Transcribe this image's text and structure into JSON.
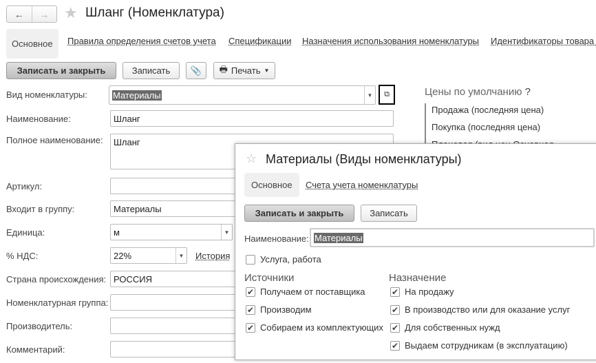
{
  "header": {
    "title": "Шланг (Номенклатура)",
    "back_icon": "arrow-left-icon",
    "forward_icon": "arrow-right-icon"
  },
  "tabs": [
    {
      "label": "Основное",
      "active": true
    },
    {
      "label": "Правила определения счетов учета"
    },
    {
      "label": "Спецификации"
    },
    {
      "label": "Назначения использования номенклатуры"
    },
    {
      "label": "Идентификаторы товара в"
    }
  ],
  "toolbar": {
    "save_close": "Записать и закрыть",
    "save": "Записать",
    "print": "Печать"
  },
  "form": {
    "kind": {
      "label": "Вид номенклатуры:",
      "value": "Материалы"
    },
    "name": {
      "label": "Наименование:",
      "value": "Шланг"
    },
    "full_name": {
      "label": "Полное наименование:",
      "value": "Шланг"
    },
    "article": {
      "label": "Артикул:",
      "value": ""
    },
    "group": {
      "label": "Входит в группу:",
      "value": "Материалы"
    },
    "unit": {
      "label": "Единица:",
      "value": "м"
    },
    "vat": {
      "label": "% НДС:",
      "value": "22%",
      "history": "История"
    },
    "country": {
      "label": "Страна происхождения:",
      "value": "РОССИЯ"
    },
    "nom_group": {
      "label": "Номенклатурная группа:",
      "value": ""
    },
    "manufacturer": {
      "label": "Производитель:",
      "value": ""
    },
    "comment": {
      "label": "Комментарий:",
      "value": ""
    }
  },
  "prices": {
    "title": "Цены по умолчанию",
    "help": "?",
    "items": [
      "Продажа (последняя цена)",
      "Покупка (последняя цена)",
      "Плановая (вид цен Основная"
    ]
  },
  "popup": {
    "title": "Материалы (Виды номенклатуры)",
    "tabs": [
      {
        "label": "Основное",
        "active": true
      },
      {
        "label": "Счета учета номенклатуры"
      }
    ],
    "save_close": "Записать и закрыть",
    "save": "Записать",
    "name_label": "Наименование:",
    "name_value": "Материалы",
    "service": {
      "label": "Услуга, работа",
      "checked": false
    },
    "sources": {
      "title": "Источники",
      "items": [
        {
          "label": "Получаем от поставщика",
          "checked": true
        },
        {
          "label": "Производим",
          "checked": true
        },
        {
          "label": "Собираем из комплектующих",
          "checked": true
        }
      ]
    },
    "purpose": {
      "title": "Назначение",
      "items": [
        {
          "label": "На продажу",
          "checked": true
        },
        {
          "label": "В производство или для оказание услуг",
          "checked": true
        },
        {
          "label": "Для собственных нужд",
          "checked": true
        },
        {
          "label": "Выдаем сотрудникам (в эксплуатацию)",
          "checked": true
        }
      ]
    }
  }
}
